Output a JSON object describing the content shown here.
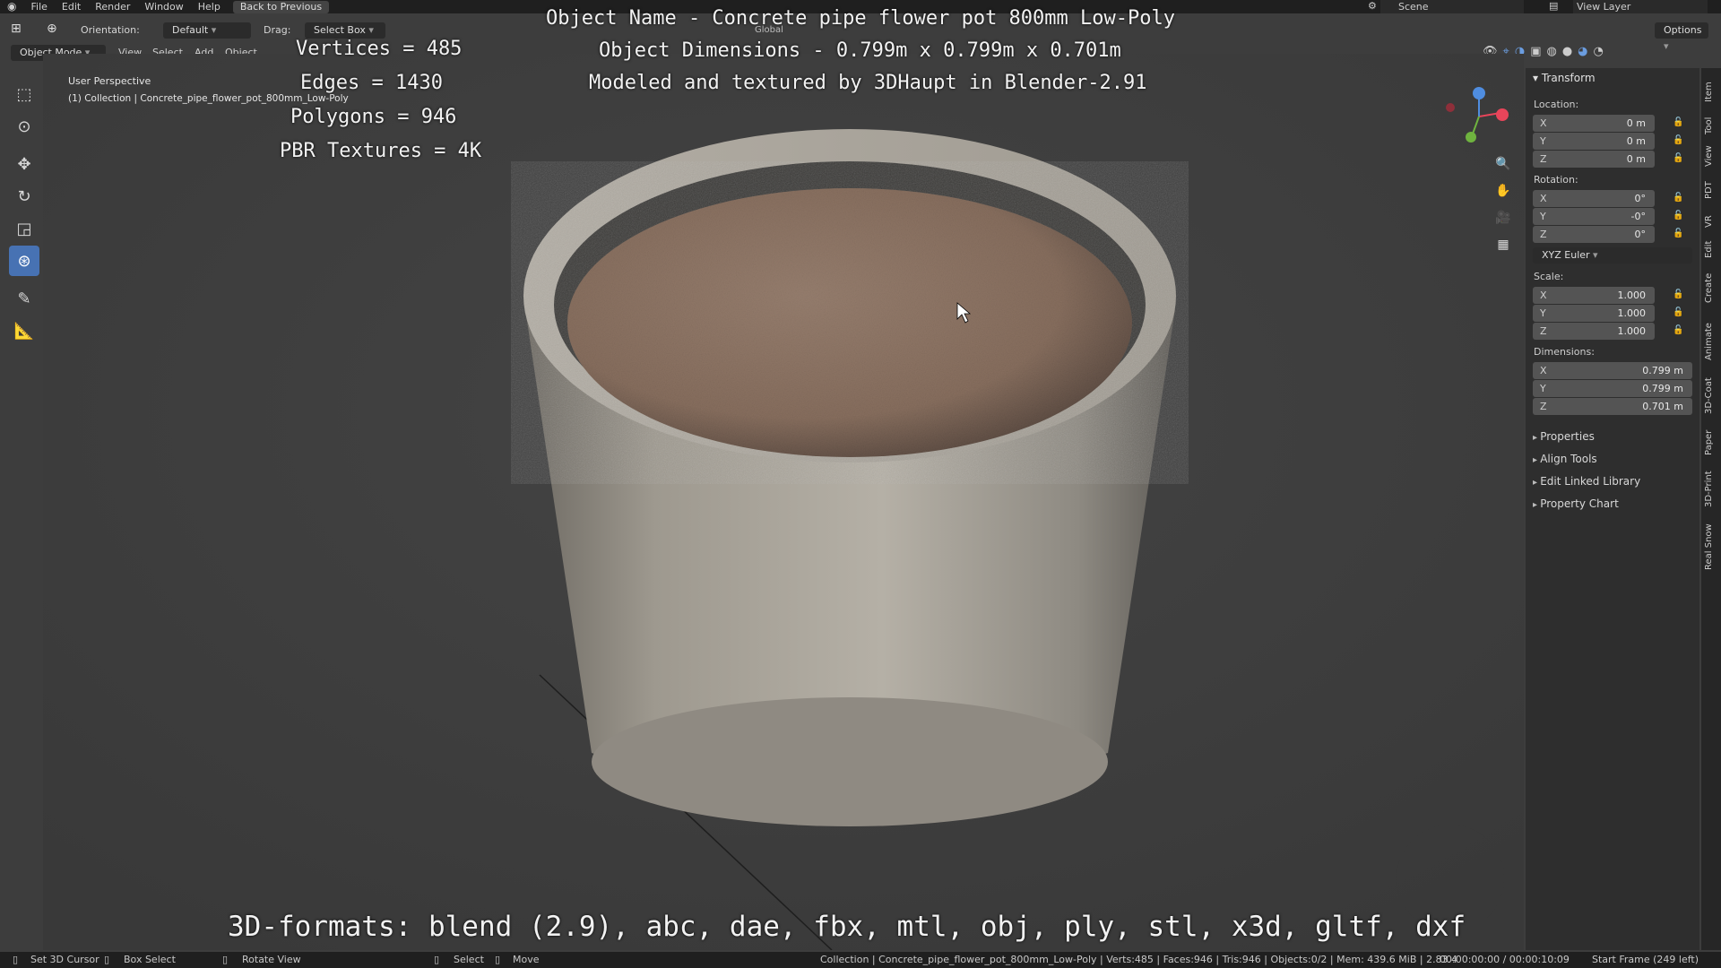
{
  "topbar": {
    "menu": [
      "File",
      "Edit",
      "Render",
      "Window",
      "Help"
    ],
    "back_label": "Back to Previous",
    "scene": "Scene",
    "view_layer": "View Layer"
  },
  "toolheader": {
    "orientation_label": "Orientation:",
    "orientation_value": "Default",
    "drag_label": "Drag:",
    "drag_value": "Select Box",
    "global_value": "Global",
    "options_label": "Options"
  },
  "viewport_header": {
    "mode": "Object Mode",
    "menus": [
      "View",
      "Select",
      "Add",
      "Object"
    ]
  },
  "viewport": {
    "perspective": "User Perspective",
    "collection": "(1) Collection | Concrete_pipe_flower_pot_800mm_Low-Poly"
  },
  "overlay": {
    "vertices": "Vertices = 485",
    "edges": "Edges = 1430",
    "polygons": "Polygons = 946",
    "textures": "PBR Textures = 4K",
    "object_name": "Object Name - Concrete pipe flower pot 800mm Low-Poly",
    "dimensions": "Object Dimensions -  0.799m x 0.799m x 0.701m",
    "credit": "Modeled and textured by 3DHaupt in Blender-2.91",
    "formats": "3D-formats: blend (2.9), abc, dae, fbx, mtl, obj, ply, stl, x3d, gltf, dxf"
  },
  "npanel": {
    "transform": "Transform",
    "location_label": "Location:",
    "location": [
      {
        "axis": "X",
        "value": "0 m"
      },
      {
        "axis": "Y",
        "value": "0 m"
      },
      {
        "axis": "Z",
        "value": "0 m"
      }
    ],
    "rotation_label": "Rotation:",
    "rotation": [
      {
        "axis": "X",
        "value": "0°"
      },
      {
        "axis": "Y",
        "value": "-0°"
      },
      {
        "axis": "Z",
        "value": "0°"
      }
    ],
    "rotation_mode": "XYZ Euler",
    "scale_label": "Scale:",
    "scale": [
      {
        "axis": "X",
        "value": "1.000"
      },
      {
        "axis": "Y",
        "value": "1.000"
      },
      {
        "axis": "Z",
        "value": "1.000"
      }
    ],
    "dimensions_label": "Dimensions:",
    "dimensions": [
      {
        "axis": "X",
        "value": "0.799 m"
      },
      {
        "axis": "Y",
        "value": "0.799 m"
      },
      {
        "axis": "Z",
        "value": "0.701 m"
      }
    ],
    "sections": [
      "Properties",
      "Align Tools",
      "Edit Linked Library",
      "Property Chart"
    ]
  },
  "side_tabs": [
    "Item",
    "Tool",
    "View",
    "PDT",
    "VR",
    "Edit",
    "Create",
    "Animate",
    "3D-Coat",
    "Paper",
    "3D-Print",
    "Real Snow"
  ],
  "statusbar": {
    "set_cursor": "Set 3D Cursor",
    "box_select": "Box Select",
    "rotate_view": "Rotate View",
    "select": "Select",
    "move": "Move",
    "info": "Collection | Concrete_pipe_flower_pot_800mm_Low-Poly | Verts:485 | Faces:946 | Tris:946 | Objects:0/2 | Mem: 439.6 MiB | 2.83.4",
    "time": "00:00:00:00 / 00:00:10:09",
    "frame": "Start Frame (249 left)"
  },
  "colors": {
    "accent": "#4772b3",
    "background": "#3d3d3d",
    "concrete": "#a29d94",
    "soil": "#8a7262"
  }
}
